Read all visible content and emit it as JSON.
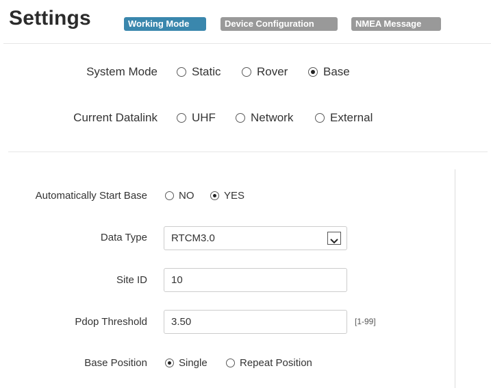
{
  "header": {
    "title": "Settings",
    "tabs": [
      {
        "label": "Working Mode",
        "active": true
      },
      {
        "label": "Device Configuration",
        "active": false
      },
      {
        "label": "NMEA Message",
        "active": false
      }
    ]
  },
  "system_mode": {
    "label": "System Mode",
    "options": [
      "Static",
      "Rover",
      "Base"
    ],
    "selected": "Base"
  },
  "current_datalink": {
    "label": "Current Datalink",
    "options": [
      "UHF",
      "Network",
      "External"
    ],
    "selected": null
  },
  "base_settings": {
    "auto_start": {
      "label": "Automatically Start Base",
      "options": [
        "NO",
        "YES"
      ],
      "selected": "YES"
    },
    "data_type": {
      "label": "Data Type",
      "value": "RTCM3.0"
    },
    "site_id": {
      "label": "Site ID",
      "value": "10"
    },
    "pdop_threshold": {
      "label": "Pdop Threshold",
      "value": "3.50",
      "range_hint": "[1-99]"
    },
    "base_position": {
      "label": "Base Position",
      "options": [
        "Single",
        "Repeat Position"
      ],
      "selected": "Single"
    }
  },
  "colors": {
    "active_tab": "#3a87ad",
    "inactive_tab": "#999999"
  }
}
